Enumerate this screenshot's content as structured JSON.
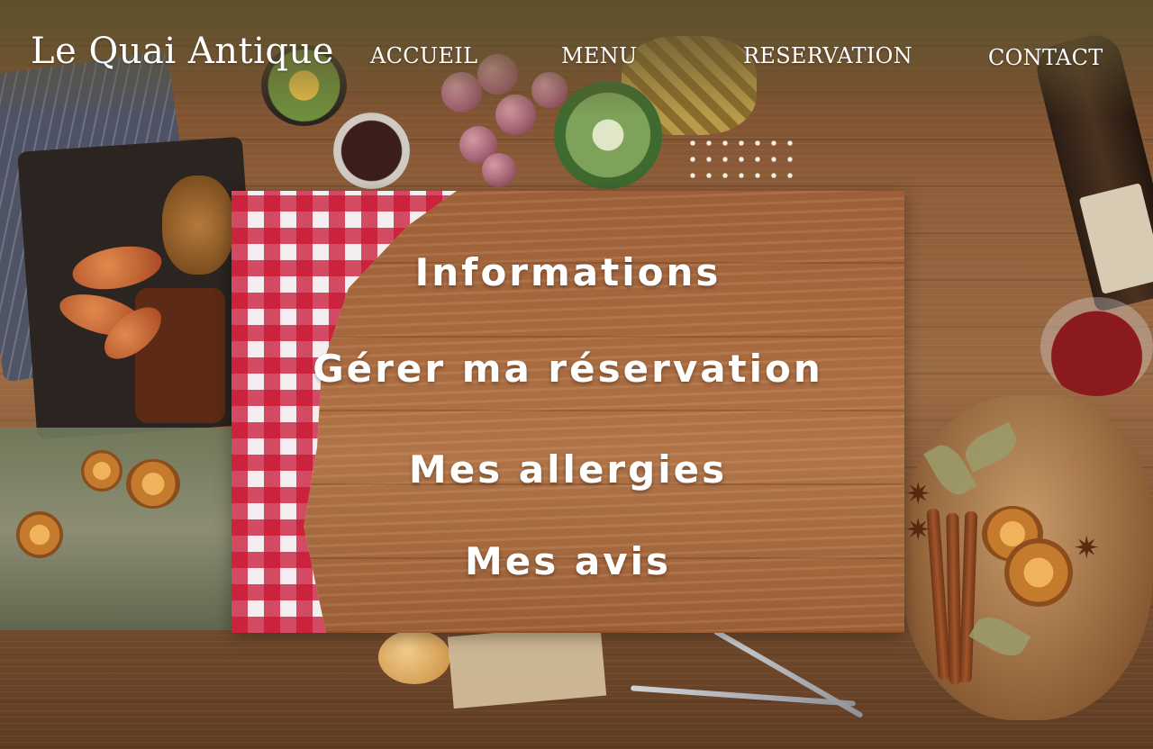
{
  "brand": {
    "logo": "Le Quai Antique"
  },
  "nav": {
    "items": [
      {
        "label": "ACCUEIL"
      },
      {
        "label": "MENU"
      },
      {
        "label": "RESERVATION"
      },
      {
        "label": "CONTACT"
      }
    ]
  },
  "panel": {
    "items": [
      {
        "label": "Informations"
      },
      {
        "label": "Gérer ma réservation"
      },
      {
        "label": "Mes allergies"
      },
      {
        "label": "Mes avis"
      }
    ]
  },
  "colors": {
    "text": "#ffffff",
    "header_tint": "#5c522c",
    "wood": "#a8693f",
    "gingham_red": "#c81432"
  }
}
